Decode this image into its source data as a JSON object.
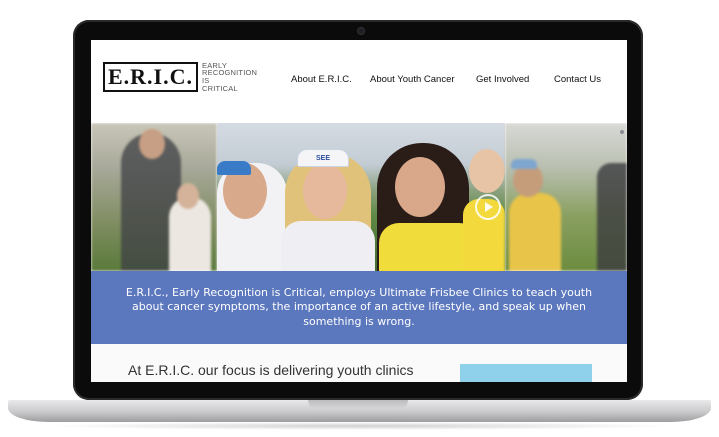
{
  "logo": {
    "letters": "E.R.I.C.",
    "tagline": [
      "EARLY",
      "RECOGNITION",
      "IS",
      "CRITICAL"
    ]
  },
  "nav": {
    "items": [
      "About E.R.I.C.",
      "About Youth Cancer",
      "Get Involved",
      "Contact Us"
    ]
  },
  "hero": {
    "play_icon": "play-circle-icon",
    "cap_text": "SEE"
  },
  "banner": {
    "text": "E.R.I.C., Early Recognition is Critical, employs Ultimate Frisbee Clinics to teach youth about cancer symptoms, the importance of an active lifestyle, and speak up when something is wrong.",
    "color": "#5b77bd"
  },
  "content": {
    "focus_text": "At E.R.I.C. our focus is delivering youth clinics"
  }
}
